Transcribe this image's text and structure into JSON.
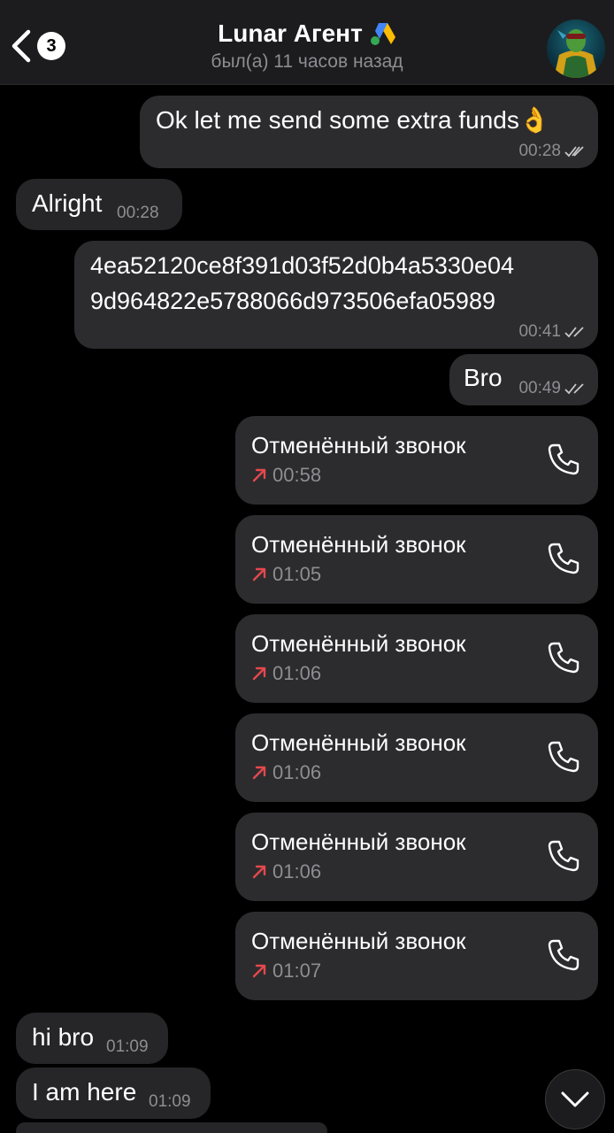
{
  "header": {
    "back_count": "3",
    "title": "Lunar Агент",
    "status": "был(а) 11 часов назад"
  },
  "messages": [
    {
      "text": "Ok let me send some extra funds👌",
      "time": "00:28"
    },
    {
      "text": "Alright",
      "time": "00:28"
    },
    {
      "line1": "4ea52120ce8f391d03f52d0b4a5330e04",
      "line2": "9d964822e5788066d973506efa05989",
      "time": "00:41"
    },
    {
      "text": "Bro",
      "time": "00:49"
    }
  ],
  "calls": [
    {
      "label": "Отменённый звонок",
      "time": "00:58"
    },
    {
      "label": "Отменённый звонок",
      "time": "01:05"
    },
    {
      "label": "Отменённый звонок",
      "time": "01:06"
    },
    {
      "label": "Отменённый звонок",
      "time": "01:06"
    },
    {
      "label": "Отменённый звонок",
      "time": "01:06"
    },
    {
      "label": "Отменённый звонок",
      "time": "01:07"
    }
  ],
  "incoming_tail": [
    {
      "text": "hi bro",
      "time": "01:09"
    },
    {
      "text": "I am here",
      "time": "01:09"
    }
  ],
  "colors": {
    "background": "#000000",
    "bubble": "#2c2c2e",
    "timestamp": "#8d8d93",
    "missed_arrow": "#e5484d"
  }
}
